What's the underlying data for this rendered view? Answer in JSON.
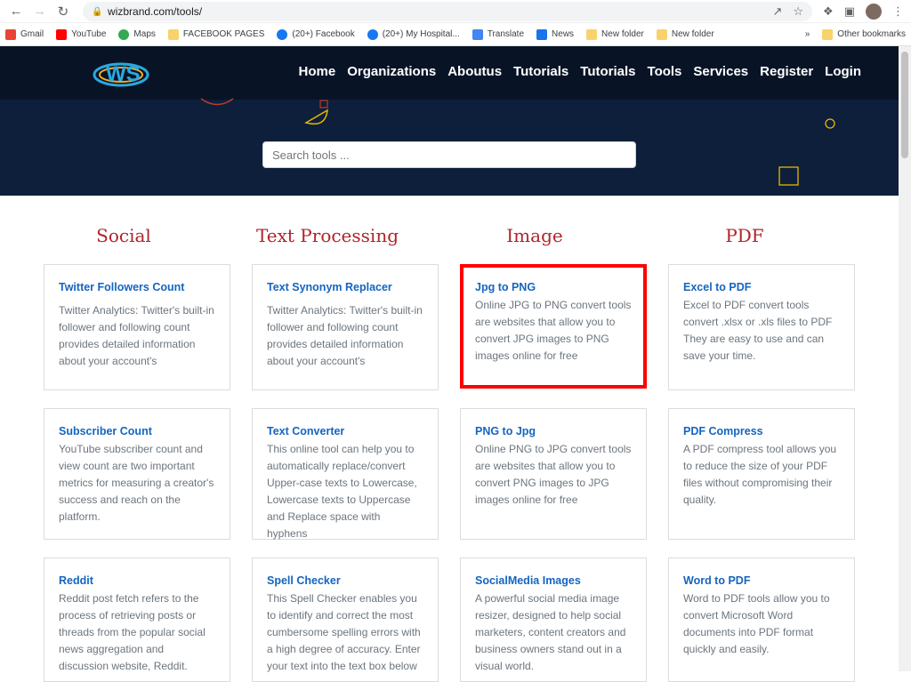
{
  "browser": {
    "url": "wizbrand.com/tools/",
    "bookmarks": [
      "Gmail",
      "YouTube",
      "Maps",
      "FACEBOOK PAGES",
      "(20+) Facebook",
      "(20+) My Hospital...",
      "Translate",
      "News",
      "New folder",
      "New folder"
    ],
    "overflow_label": "»",
    "other_bookmarks": "Other bookmarks"
  },
  "site": {
    "logo": "WS",
    "nav": [
      "Home",
      "Organizations",
      "Aboutus",
      "Tutorials",
      "Tutorials",
      "Tools",
      "Services",
      "Register",
      "Login"
    ],
    "search_placeholder": "Search tools ..."
  },
  "columns": [
    {
      "title": "Social",
      "cards": [
        {
          "title": "Twitter Followers Count",
          "desc": "Twitter Analytics: Twitter's built-in follower and following count provides detailed information about your account's"
        },
        {
          "title": "Subscriber Count",
          "desc": "YouTube subscriber count and view count are two important metrics for measuring a creator's success and reach on the platform."
        },
        {
          "title": "Reddit",
          "desc": "Reddit post fetch refers to the process of retrieving posts or threads from the popular social news aggregation and discussion website, Reddit."
        }
      ]
    },
    {
      "title": "Text Processing",
      "cards": [
        {
          "title": "Text Synonym Replacer",
          "desc": "Twitter Analytics: Twitter's built-in follower and following count provides detailed information about your account's"
        },
        {
          "title": "Text Converter",
          "desc": "This online tool can help you to automatically replace/convert Upper-case texts to Lowercase, Lowercase texts to Uppercase and Replace space with hyphens"
        },
        {
          "title": "Spell Checker",
          "desc": "This Spell Checker enables you to identify and correct the most cumbersome spelling errors with a high degree of accuracy. Enter your text into the text box below"
        }
      ]
    },
    {
      "title": "Image",
      "cards": [
        {
          "title": "Jpg to PNG",
          "desc": "Online JPG to PNG convert tools are websites that allow you to convert JPG images to PNG images online for free"
        },
        {
          "title": "PNG to Jpg",
          "desc": "Online PNG to JPG convert tools are websites that allow you to convert PNG images to JPG images online for free"
        },
        {
          "title": "SocialMedia Images",
          "desc": "A powerful social media image resizer, designed to help social marketers, content creators and business owners stand out in a visual world."
        }
      ]
    },
    {
      "title": "PDF",
      "cards": [
        {
          "title": "Excel to PDF",
          "desc": "Excel to PDF convert tools convert .xlsx or .xls files to PDF They are easy to use and can save your time."
        },
        {
          "title": "PDF Compress",
          "desc": "A PDF compress tool allows you to reduce the size of your PDF files without compromising their quality."
        },
        {
          "title": "Word to PDF",
          "desc": "Word to PDF tools allow you to convert Microsoft Word documents into PDF format quickly and easily."
        }
      ]
    }
  ],
  "colors": {
    "heading": "#b0232b",
    "link": "#1565c0",
    "highlight": "#ff0000",
    "hero": "#0d1f3a"
  }
}
